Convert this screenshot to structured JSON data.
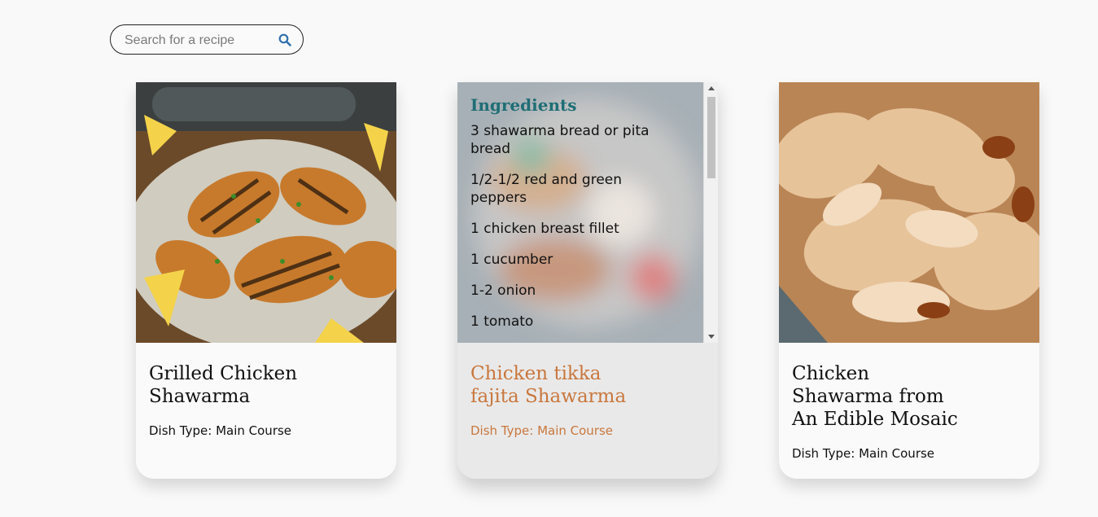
{
  "search": {
    "placeholder": "Search for a recipe",
    "icon": "search-icon"
  },
  "cards": [
    {
      "title_line1": "Grilled Chicken",
      "title_line2": "Shawarma",
      "title_line3": "",
      "dish_type": "Dish Type: Main Course"
    },
    {
      "title_line1": "Chicken tikka",
      "title_line2": "fajita Shawarma",
      "title_line3": "",
      "dish_type": "Dish Type: Main Course",
      "ingredients_heading": "Ingredients",
      "ingredients": [
        "3 shawarma bread or pita bread",
        "1/2-1/2 red and green peppers",
        "1 chicken breast fillet",
        "1 cucumber",
        "1-2 onion",
        "1 tomato"
      ]
    },
    {
      "title_line1": "Chicken",
      "title_line2": "Shawarma from",
      "title_line3": "An Edible Mosaic",
      "dish_type": "Dish Type: Main Course"
    }
  ],
  "colors": {
    "accent": "#c9773d",
    "ingredients_heading": "#1f6e75"
  }
}
